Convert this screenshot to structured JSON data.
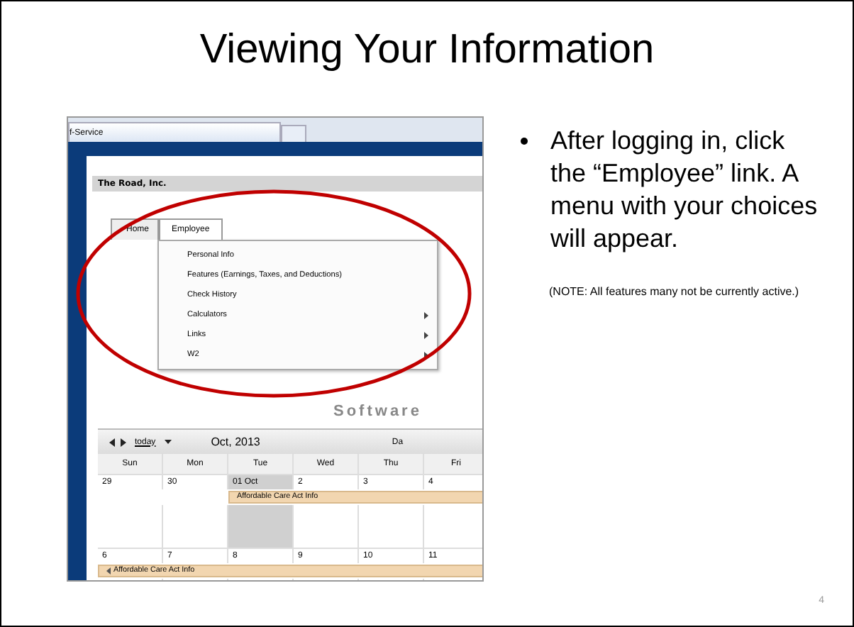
{
  "slide": {
    "title": "Viewing Your Information",
    "bullets": [
      "After logging in, click the “Employee” link. A menu with your choices will appear."
    ],
    "note": "(NOTE:  All features many not be currently active.)",
    "page_number": "4"
  },
  "screenshot": {
    "browser_tab": "f-Service",
    "company": "The Road, Inc.",
    "nav_tabs": [
      {
        "label": "Home",
        "selected": false
      },
      {
        "label": "Employee",
        "selected": true
      }
    ],
    "menu": [
      {
        "label": "Personal Info",
        "submenu": false
      },
      {
        "label": "Features (Earnings, Taxes, and Deductions)",
        "submenu": false
      },
      {
        "label": "Check History",
        "submenu": false
      },
      {
        "label": "Calculators",
        "submenu": true
      },
      {
        "label": "Links",
        "submenu": true
      },
      {
        "label": "W2",
        "submenu": true
      }
    ],
    "logo_text": "Software",
    "calendar": {
      "today_link": "today",
      "month": "Oct, 2013",
      "view_label": "Da",
      "days": [
        "Sun",
        "Mon",
        "Tue",
        "Wed",
        "Thu",
        "Fri"
      ],
      "weeks": [
        {
          "cells": [
            {
              "date": "29",
              "selected": false
            },
            {
              "date": "30",
              "selected": false
            },
            {
              "date": "01 Oct",
              "selected": true,
              "event": "Affordable Care Act Info",
              "event_continued": false
            },
            {
              "date": "2",
              "selected": false
            },
            {
              "date": "3",
              "selected": false
            },
            {
              "date": "4",
              "selected": false
            }
          ]
        },
        {
          "cells": [
            {
              "date": "6",
              "selected": false,
              "event": "Affordable Care Act Info",
              "event_continued": true
            },
            {
              "date": "7",
              "selected": false
            },
            {
              "date": "8",
              "selected": false
            },
            {
              "date": "9",
              "selected": false
            },
            {
              "date": "10",
              "selected": false
            },
            {
              "date": "11",
              "selected": false
            }
          ]
        }
      ]
    }
  }
}
